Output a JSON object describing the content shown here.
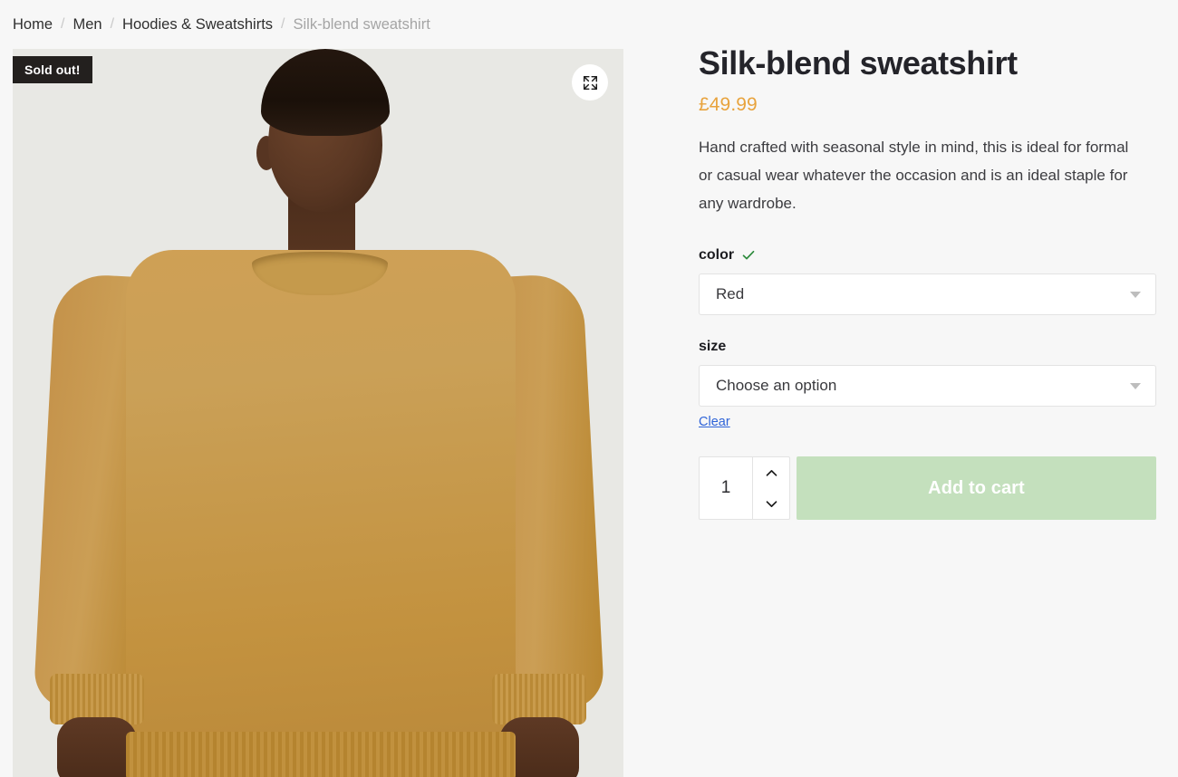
{
  "breadcrumb": {
    "separator": "/",
    "items": [
      {
        "label": "Home",
        "current": false
      },
      {
        "label": "Men",
        "current": false
      },
      {
        "label": "Hoodies & Sweatshirts",
        "current": false
      },
      {
        "label": "Silk-blend sweatshirt",
        "current": true
      }
    ]
  },
  "gallery": {
    "badge": "Sold out!",
    "expand_icon": "expand-fullscreen-icon",
    "image_alt": "Model wearing mustard silk-blend sweatshirt with blue jeans",
    "background_color": "#e8e8e4",
    "garment_color": "#c99b4c"
  },
  "product": {
    "title": "Silk-blend sweatshirt",
    "price": "£49.99",
    "price_color": "#e8a33d",
    "description": "Hand crafted with seasonal style in mind, this is ideal for formal or casual wear whatever the occasion and is an ideal staple for any wardrobe."
  },
  "variations": [
    {
      "label": "color",
      "selected": "Red",
      "has_check": true,
      "check_icon": "check-icon",
      "check_color": "#2e8b3d",
      "caret_icon": "chevron-down-icon"
    },
    {
      "label": "size",
      "selected": "Choose an option",
      "has_check": false,
      "caret_icon": "chevron-down-icon"
    }
  ],
  "clear_label": "Clear",
  "cart": {
    "quantity": "1",
    "quantity_placeholder": "1",
    "increase_icon": "chevron-up-icon",
    "decrease_icon": "chevron-down-icon",
    "add_to_cart_label": "Add to cart",
    "add_to_cart_color": "#c4e0bd"
  }
}
